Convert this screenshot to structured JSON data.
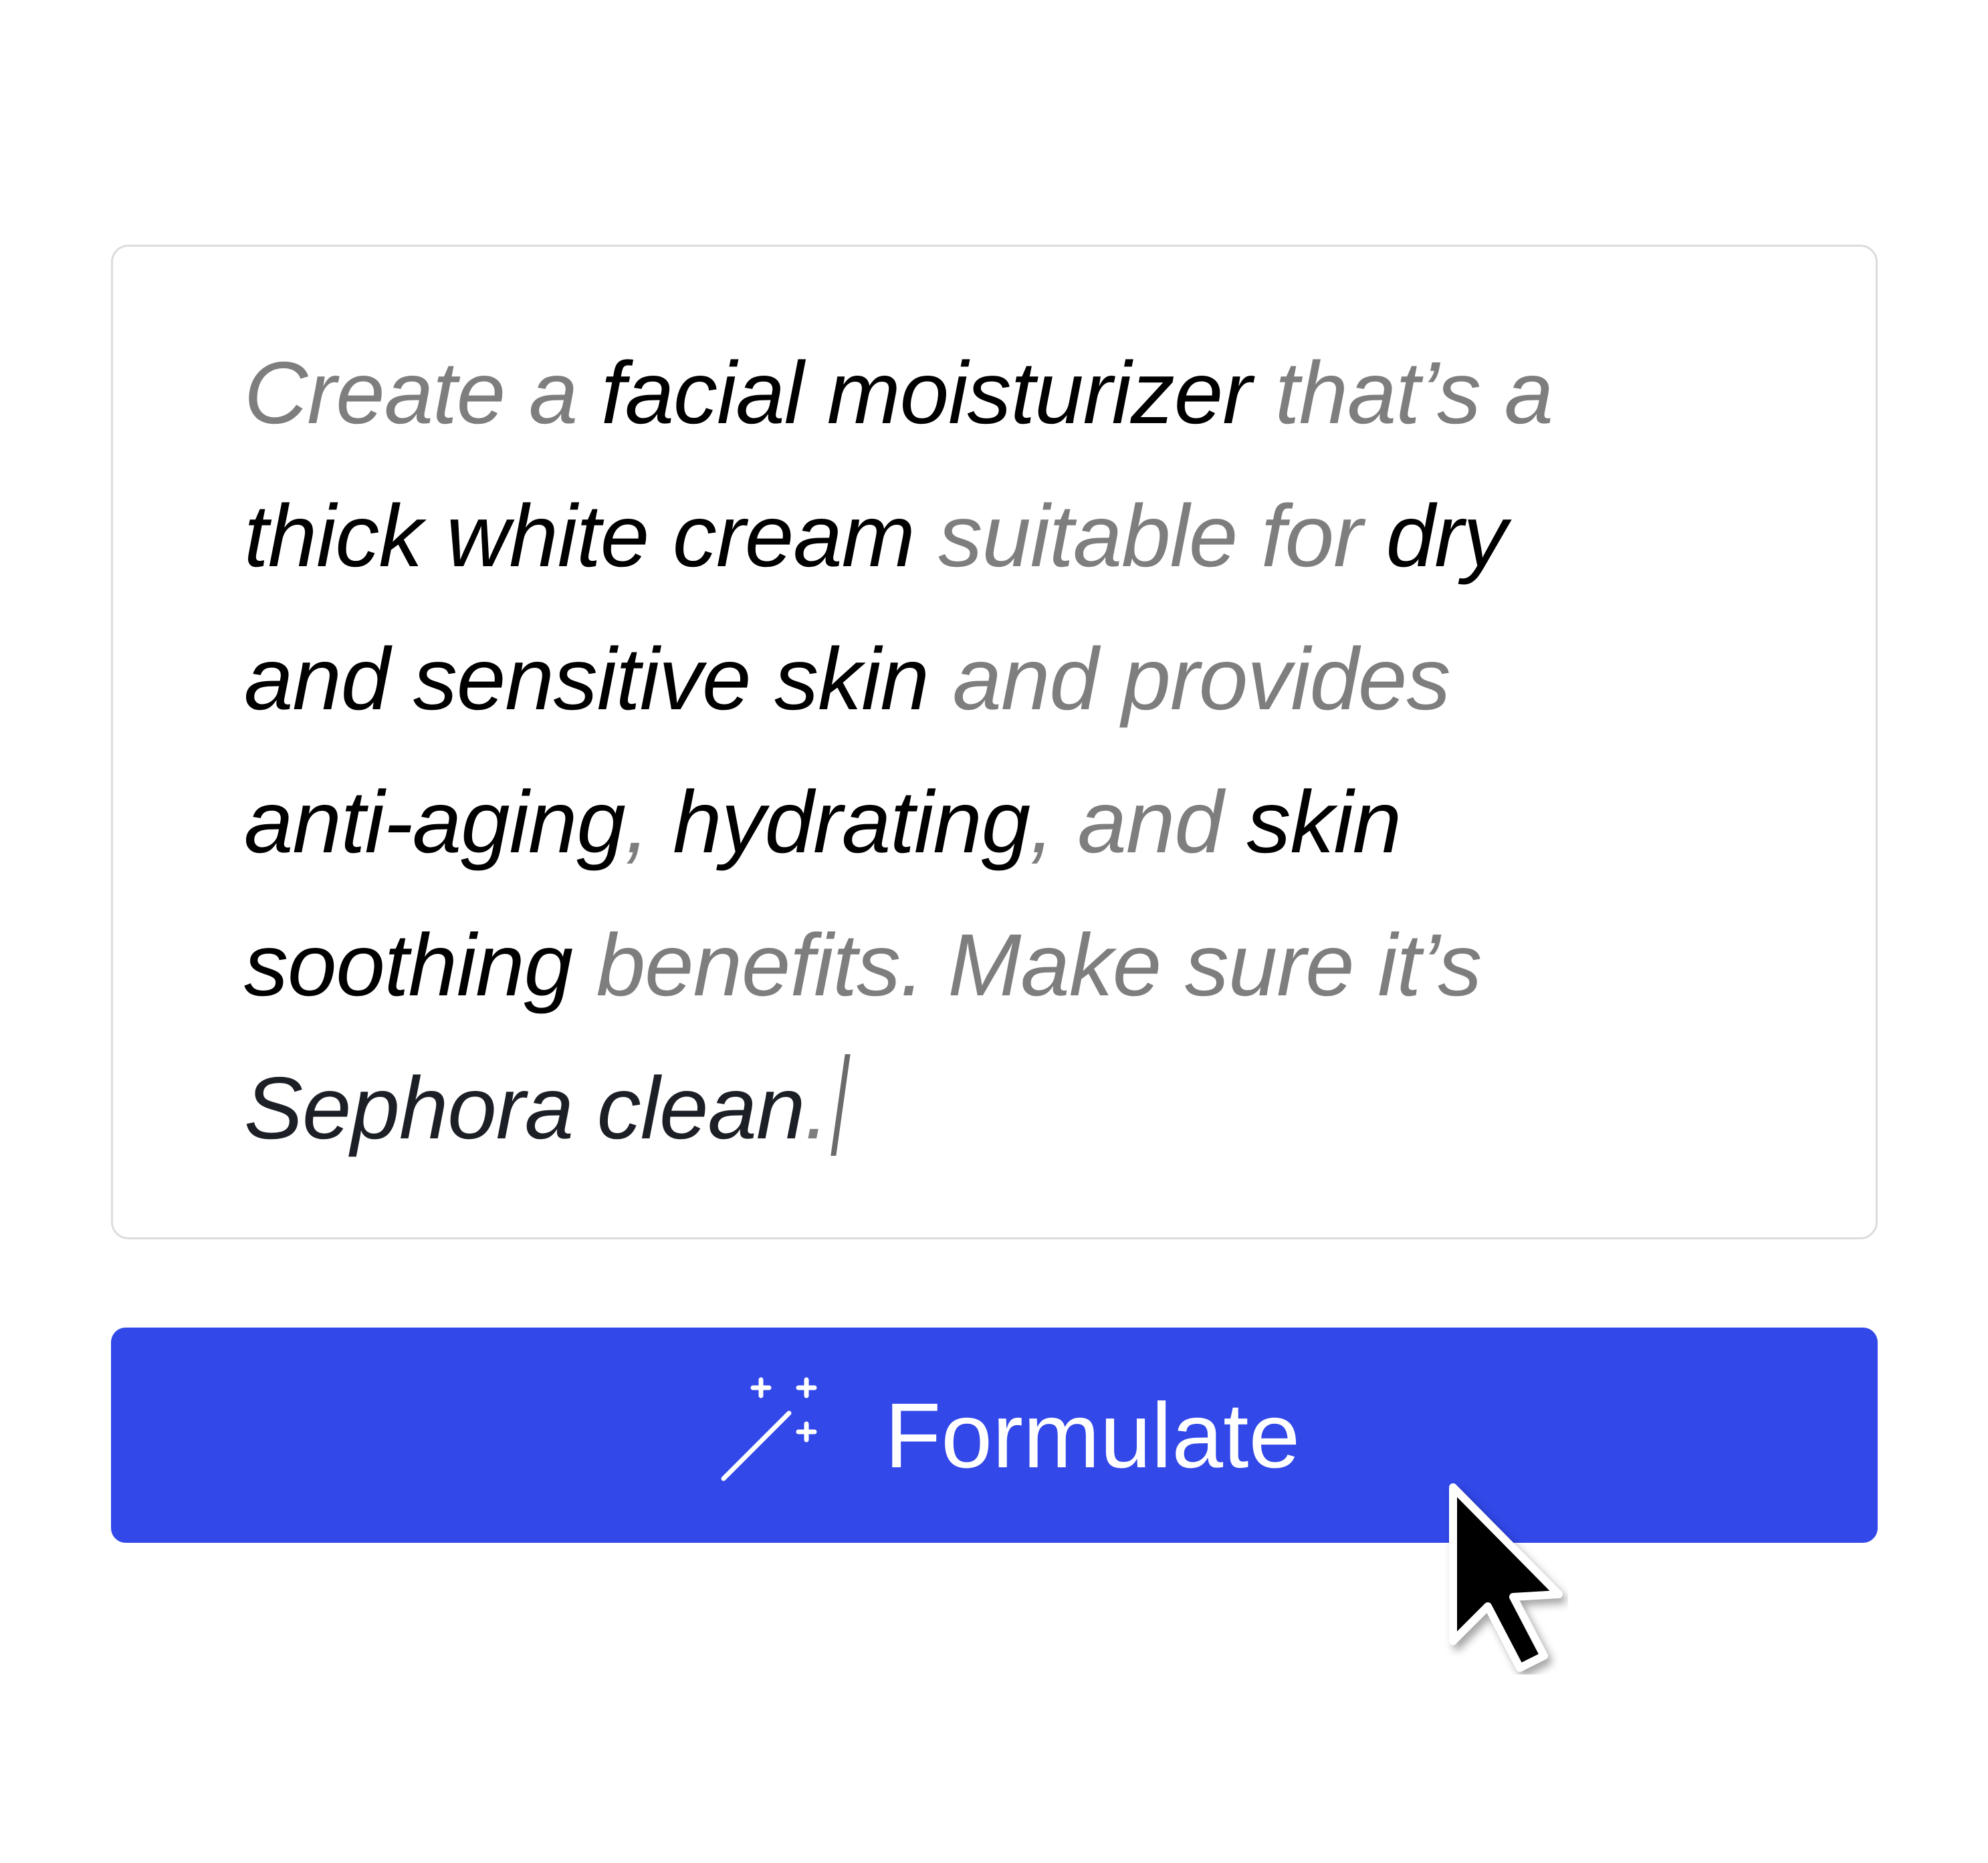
{
  "prompt": {
    "lines": [
      [
        {
          "text": "Create a ",
          "style": "plain"
        },
        {
          "text": "facial moisturizer",
          "style": "key"
        },
        {
          "text": " that’s a",
          "style": "plain"
        }
      ],
      [
        {
          "text": "thick white cream",
          "style": "key"
        },
        {
          "text": " suitable for ",
          "style": "plain"
        },
        {
          "text": "dry",
          "style": "key"
        }
      ],
      [
        {
          "text": "and sensitive skin",
          "style": "key"
        },
        {
          "text": " and provides",
          "style": "plain"
        }
      ],
      [
        {
          "text": "anti-aging",
          "style": "key"
        },
        {
          "text": ", ",
          "style": "plain"
        },
        {
          "text": "hydrating",
          "style": "key"
        },
        {
          "text": ", and ",
          "style": "plain"
        },
        {
          "text": "skin",
          "style": "key"
        }
      ],
      [
        {
          "text": "soothing",
          "style": "key"
        },
        {
          "text": " benefits. Make sure it’s",
          "style": "plain"
        }
      ],
      [
        {
          "text": "Sephora clean",
          "style": "tail"
        },
        {
          "text": ".",
          "style": "plain"
        }
      ]
    ]
  },
  "button": {
    "label": "Formulate",
    "icon": "magic-wand-icon",
    "color": "#3248E8"
  },
  "colors": {
    "muted_text": "#7E7E7E",
    "highlight_text": "#000000",
    "card_border": "#DCDCDC"
  }
}
